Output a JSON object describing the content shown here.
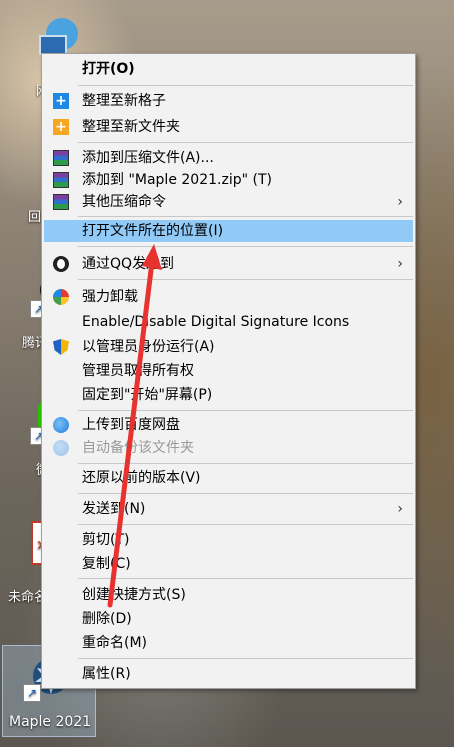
{
  "desktop": {
    "icons": [
      {
        "label": "网",
        "name": "network"
      },
      {
        "label": "回",
        "name": "recycle-bin"
      },
      {
        "label": "腾讯",
        "name": "tencent"
      },
      {
        "label": "微",
        "name": "wechat"
      },
      {
        "label": "未命名",
        "name": "untitled"
      },
      {
        "label": "Maple 2021",
        "name": "maple-2021"
      }
    ]
  },
  "menu": {
    "items": [
      {
        "label": "打开(O)",
        "bold": true
      },
      {
        "label": "整理至新格子",
        "icon": "plus-blue-icon"
      },
      {
        "label": "整理至新文件夹",
        "icon": "plus-orange-icon"
      },
      {
        "label": "添加到压缩文件(A)...",
        "icon": "winrar-icon"
      },
      {
        "label": "添加到 \"Maple 2021.zip\" (T)",
        "icon": "winrar-icon"
      },
      {
        "label": "其他压缩命令",
        "icon": "winrar-icon",
        "submenu": true
      },
      {
        "label": "打开文件所在的位置(I)",
        "highlighted": true
      },
      {
        "label": "通过QQ发送到",
        "icon": "qq-icon",
        "submenu": true
      },
      {
        "label": "强力卸载",
        "icon": "uninstall-icon"
      },
      {
        "label": "Enable/Disable Digital Signature Icons"
      },
      {
        "label": "以管理员身份运行(A)",
        "icon": "uac-shield-icon"
      },
      {
        "label": "管理员取得所有权"
      },
      {
        "label": "固定到\"开始\"屏幕(P)"
      },
      {
        "label": "上传到百度网盘",
        "icon": "baidu-cloud-icon"
      },
      {
        "label": "自动备份该文件夹",
        "icon": "baidu-cloud-icon",
        "disabled": true
      },
      {
        "label": "还原以前的版本(V)"
      },
      {
        "label": "发送到(N)",
        "submenu": true
      },
      {
        "label": "剪切(T)"
      },
      {
        "label": "复制(C)"
      },
      {
        "label": "创建快捷方式(S)"
      },
      {
        "label": "删除(D)"
      },
      {
        "label": "重命名(M)"
      },
      {
        "label": "属性(R)"
      }
    ],
    "submenu_glyph": "›"
  },
  "colors": {
    "highlight": "#91c9f7",
    "annotation_arrow": "#e8322f"
  }
}
